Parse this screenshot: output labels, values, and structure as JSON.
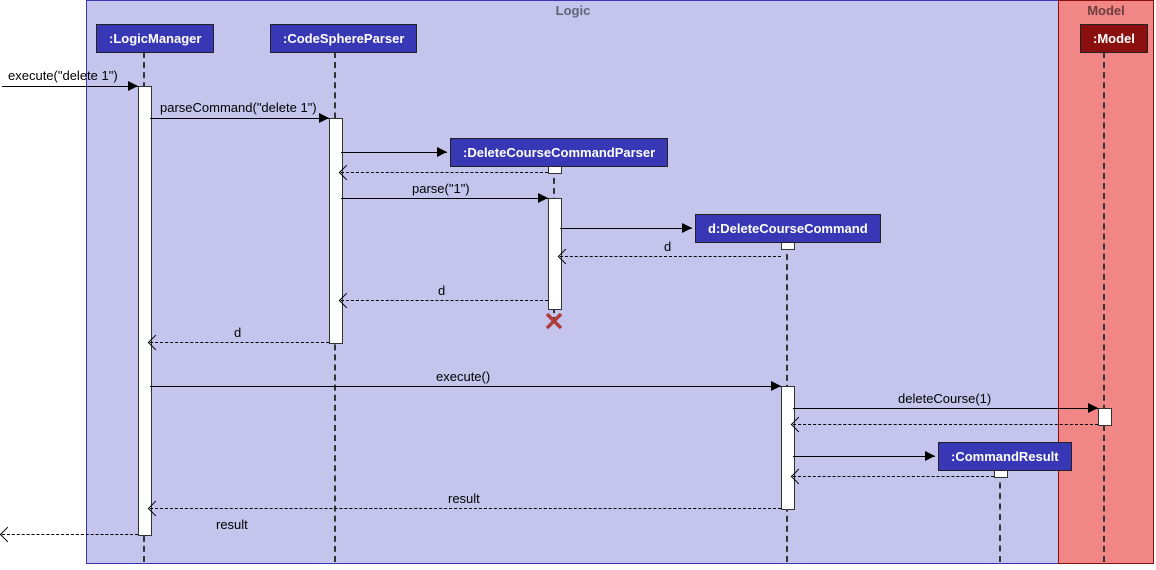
{
  "modules": {
    "logic": {
      "label": "Logic",
      "bg": "#c4c4ec",
      "border": "#3838b6"
    },
    "model": {
      "label": "Model",
      "bg": "#f08686",
      "border": "#8b0f0f"
    }
  },
  "actors": {
    "logicManager": {
      "label": ":LogicManager",
      "bg": "#3838b6"
    },
    "codeSphereParser": {
      "label": ":CodeSphereParser",
      "bg": "#3838b6"
    },
    "deleteCourseParser": {
      "label": ":DeleteCourseCommandParser",
      "bg": "#3838b6"
    },
    "deleteCourseCmd": {
      "label": "d:DeleteCourseCommand",
      "bg": "#3838b6"
    },
    "commandResult": {
      "label": ":CommandResult",
      "bg": "#3838b6"
    },
    "model": {
      "label": ":Model",
      "bg": "#8b0f0f"
    }
  },
  "messages": {
    "executeDelete1": "execute(\"delete 1\")",
    "parseCommand": "parseCommand(\"delete 1\")",
    "parse1": "parse(\"1\")",
    "d1": "d",
    "d2": "d",
    "d3": "d",
    "execute": "execute()",
    "deleteCourse": "deleteCourse(1)",
    "result1": "result",
    "result2": "result"
  }
}
